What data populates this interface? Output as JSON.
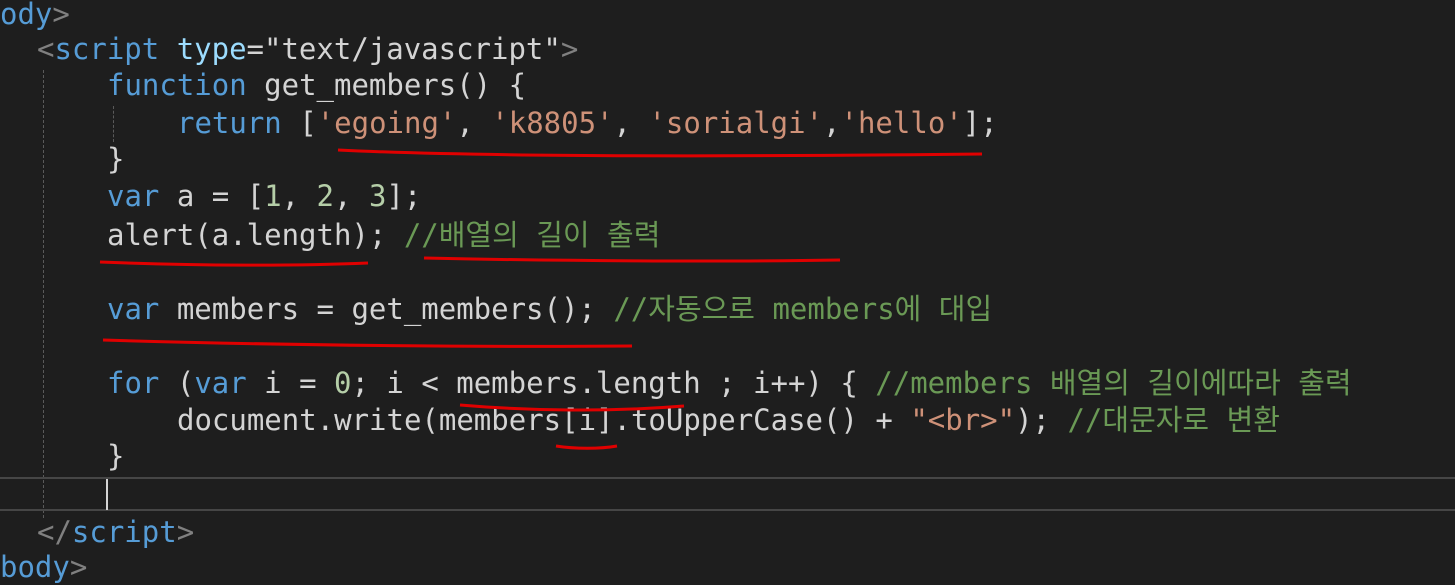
{
  "editor": {
    "lines": [
      {
        "tokens": [
          {
            "t": "ody",
            "c": "tag"
          },
          {
            "t": ">",
            "c": "punct"
          }
        ]
      },
      {
        "tokens": [
          {
            "t": "<",
            "c": "punct"
          },
          {
            "t": "script",
            "c": "tag"
          },
          {
            "t": " ",
            "c": "plain"
          },
          {
            "t": "type",
            "c": "var"
          },
          {
            "t": "=",
            "c": "plain"
          },
          {
            "t": "\"text/javascript\"",
            "c": "plain"
          },
          {
            "t": ">",
            "c": "punct"
          }
        ]
      },
      {
        "tokens": [
          {
            "t": "function",
            "c": "kw"
          },
          {
            "t": " get_members() {",
            "c": "plain"
          }
        ]
      },
      {
        "tokens": [
          {
            "t": "return",
            "c": "kw"
          },
          {
            "t": " [",
            "c": "plain"
          },
          {
            "t": "'egoing'",
            "c": "str"
          },
          {
            "t": ", ",
            "c": "plain"
          },
          {
            "t": "'k8805'",
            "c": "str"
          },
          {
            "t": ", ",
            "c": "plain"
          },
          {
            "t": "'sorialgi'",
            "c": "str"
          },
          {
            "t": ",",
            "c": "plain"
          },
          {
            "t": "'hello'",
            "c": "str"
          },
          {
            "t": "];",
            "c": "plain"
          }
        ]
      },
      {
        "tokens": [
          {
            "t": "}",
            "c": "plain"
          }
        ]
      },
      {
        "tokens": [
          {
            "t": "var",
            "c": "kw"
          },
          {
            "t": " a = [",
            "c": "plain"
          },
          {
            "t": "1",
            "c": "num"
          },
          {
            "t": ", ",
            "c": "plain"
          },
          {
            "t": "2",
            "c": "num"
          },
          {
            "t": ", ",
            "c": "plain"
          },
          {
            "t": "3",
            "c": "num"
          },
          {
            "t": "];",
            "c": "plain"
          }
        ]
      },
      {
        "tokens": [
          {
            "t": "alert(a.length); ",
            "c": "plain"
          },
          {
            "t": "//배열의 길이 출력",
            "c": "cmt"
          }
        ]
      },
      {
        "tokens": []
      },
      {
        "tokens": [
          {
            "t": "var",
            "c": "kw"
          },
          {
            "t": " members = get_members(); ",
            "c": "plain"
          },
          {
            "t": "//자동으로 members에 대입",
            "c": "cmt"
          }
        ]
      },
      {
        "tokens": []
      },
      {
        "tokens": [
          {
            "t": "for",
            "c": "kw"
          },
          {
            "t": " (",
            "c": "plain"
          },
          {
            "t": "var",
            "c": "kw"
          },
          {
            "t": " i = ",
            "c": "plain"
          },
          {
            "t": "0",
            "c": "num"
          },
          {
            "t": "; i < members.length ; i++) { ",
            "c": "plain"
          },
          {
            "t": "//members 배열의 길이에따라 출력",
            "c": "cmt"
          }
        ]
      },
      {
        "tokens": [
          {
            "t": "document.write(members[i].toUpperCase() + ",
            "c": "plain"
          },
          {
            "t": "\"<br>\"",
            "c": "str"
          },
          {
            "t": "); ",
            "c": "plain"
          },
          {
            "t": "//대문자로 변환",
            "c": "cmt"
          }
        ]
      },
      {
        "tokens": [
          {
            "t": "}",
            "c": "plain"
          }
        ]
      },
      {
        "tokens": []
      },
      {
        "tokens": [
          {
            "t": "</",
            "c": "punct"
          },
          {
            "t": "script",
            "c": "tag"
          },
          {
            "t": ">",
            "c": "punct"
          }
        ]
      },
      {
        "tokens": [
          {
            "t": "body",
            "c": "tag"
          },
          {
            "t": ">",
            "c": "punct"
          }
        ]
      }
    ]
  },
  "colors": {
    "background": "#1e1e1e",
    "keyword": "#569cd6",
    "string": "#ce9178",
    "comment": "#6a9955",
    "number": "#b5cea8",
    "annotation": "#e00000"
  }
}
